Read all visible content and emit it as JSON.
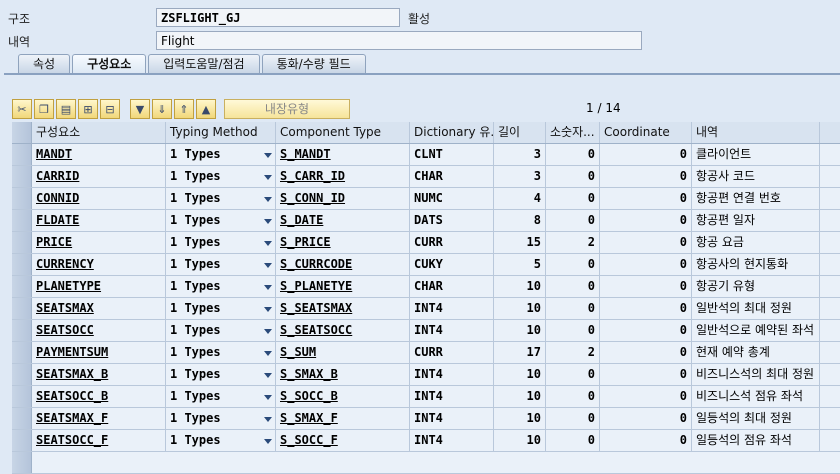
{
  "header": {
    "structure_label": "구조",
    "structure_value": "ZSFLIGHT_GJ",
    "status": "활성",
    "desc_label": "내역",
    "desc_value": "Flight"
  },
  "tabs": [
    {
      "label": "속성",
      "active": false
    },
    {
      "label": "구성요소",
      "active": true
    },
    {
      "label": "입력도움말/점검",
      "active": false
    },
    {
      "label": "통화/수량 필드",
      "active": false
    }
  ],
  "toolbar": {
    "buttons": [
      "cut-icon",
      "copy-icon",
      "paste-icon",
      "insert-row-icon",
      "delete-row-icon",
      "sort-down-icon",
      "move-down-icon",
      "move-up-icon",
      "sort-up-icon"
    ],
    "builtin_type_label": "내장유형"
  },
  "pager": {
    "current": "1",
    "separator": "/",
    "total": "14"
  },
  "table": {
    "headers": [
      "구성요소",
      "Typing Method",
      "Component Type",
      "Dictionary 유...",
      "길이",
      "소숫자...",
      "Coordinate",
      "내역"
    ],
    "rows": [
      {
        "name": "MANDT",
        "typing": "1 Types",
        "comp": "S_MANDT",
        "dict": "CLNT",
        "len": "3",
        "dec": "0",
        "coord": "0",
        "desc": "클라이언트"
      },
      {
        "name": "CARRID",
        "typing": "1 Types",
        "comp": "S_CARR_ID",
        "dict": "CHAR",
        "len": "3",
        "dec": "0",
        "coord": "0",
        "desc": "항공사 코드"
      },
      {
        "name": "CONNID",
        "typing": "1 Types",
        "comp": "S_CONN_ID",
        "dict": "NUMC",
        "len": "4",
        "dec": "0",
        "coord": "0",
        "desc": "항공편 연결 번호"
      },
      {
        "name": "FLDATE",
        "typing": "1 Types",
        "comp": "S_DATE",
        "dict": "DATS",
        "len": "8",
        "dec": "0",
        "coord": "0",
        "desc": "항공편 일자"
      },
      {
        "name": "PRICE",
        "typing": "1 Types",
        "comp": "S_PRICE",
        "dict": "CURR",
        "len": "15",
        "dec": "2",
        "coord": "0",
        "desc": "항공 요금"
      },
      {
        "name": "CURRENCY",
        "typing": "1 Types",
        "comp": "S_CURRCODE",
        "dict": "CUKY",
        "len": "5",
        "dec": "0",
        "coord": "0",
        "desc": "항공사의 현지통화"
      },
      {
        "name": "PLANETYPE",
        "typing": "1 Types",
        "comp": "S_PLANETYE",
        "dict": "CHAR",
        "len": "10",
        "dec": "0",
        "coord": "0",
        "desc": "항공기 유형"
      },
      {
        "name": "SEATSMAX",
        "typing": "1 Types",
        "comp": "S_SEATSMAX",
        "dict": "INT4",
        "len": "10",
        "dec": "0",
        "coord": "0",
        "desc": "일반석의 최대 정원"
      },
      {
        "name": "SEATSOCC",
        "typing": "1 Types",
        "comp": "S_SEATSOCC",
        "dict": "INT4",
        "len": "10",
        "dec": "0",
        "coord": "0",
        "desc": "일반석으로 예약된 좌석"
      },
      {
        "name": "PAYMENTSUM",
        "typing": "1 Types",
        "comp": "S_SUM",
        "dict": "CURR",
        "len": "17",
        "dec": "2",
        "coord": "0",
        "desc": "현재 예약 총계"
      },
      {
        "name": "SEATSMAX_B",
        "typing": "1 Types",
        "comp": "S_SMAX_B",
        "dict": "INT4",
        "len": "10",
        "dec": "0",
        "coord": "0",
        "desc": "비즈니스석의 최대 정원"
      },
      {
        "name": "SEATSOCC_B",
        "typing": "1 Types",
        "comp": "S_SOCC_B",
        "dict": "INT4",
        "len": "10",
        "dec": "0",
        "coord": "0",
        "desc": "비즈니스석 점유 좌석"
      },
      {
        "name": "SEATSMAX_F",
        "typing": "1 Types",
        "comp": "S_SMAX_F",
        "dict": "INT4",
        "len": "10",
        "dec": "0",
        "coord": "0",
        "desc": "일등석의 최대 정원"
      },
      {
        "name": "SEATSOCC_F",
        "typing": "1 Types",
        "comp": "S_SOCC_F",
        "dict": "INT4",
        "len": "10",
        "dec": "0",
        "coord": "0",
        "desc": "일등석의 점유 좌석"
      }
    ]
  }
}
